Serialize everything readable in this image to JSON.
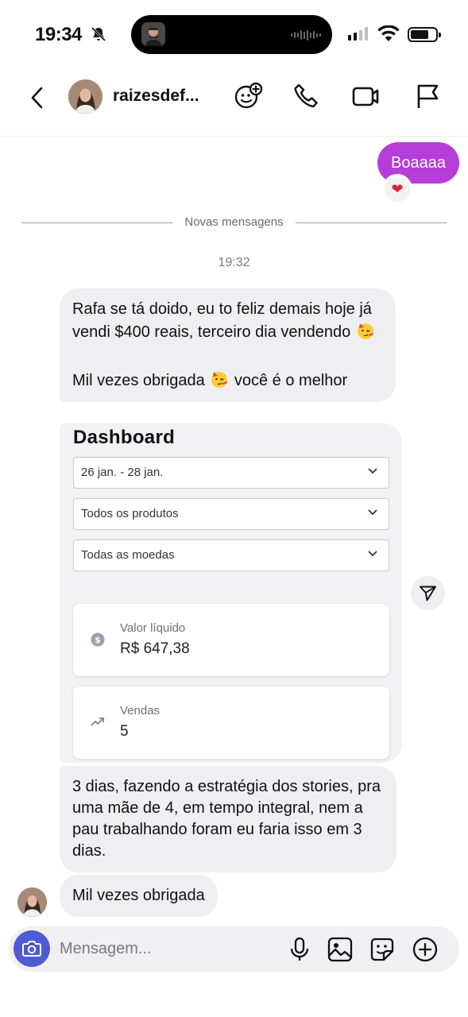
{
  "status_bar": {
    "time": "19:34"
  },
  "header": {
    "username": "raizesdef..."
  },
  "messages": {
    "outgoing_text": "Boaaaa",
    "reaction": "❤",
    "divider_label": "Novas mensagens",
    "timestamp": "19:32",
    "bubble1_line1": "Rafa se tá doido, eu to feliz demais hoje já vendi $400 reais, terceiro dia vendendo",
    "bubble1_line2a": "Mil vezes obrigada",
    "bubble1_line2b": "você é o melhor",
    "bubble3": "3 dias, fazendo a estratégia dos stories, pra uma mãe de 4, em tempo integral, nem a pau trabalhando foram eu faria isso em 3 dias.",
    "bubble4": "Mil vezes obrigada"
  },
  "dashboard": {
    "title": "Dashboard",
    "date_filter": "26 jan. - 28 jan.",
    "product_filter": "Todos os produtos",
    "currency_filter": "Todas as moedas",
    "card1_label": "Valor líquido",
    "card1_value": "R$ 647,38",
    "card2_label": "Vendas",
    "card2_value": "5"
  },
  "composer": {
    "placeholder": "Mensagem..."
  }
}
